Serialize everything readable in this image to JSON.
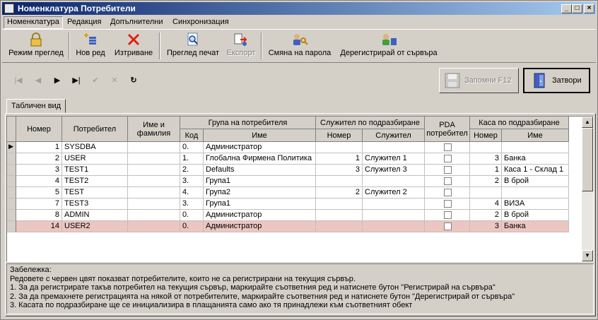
{
  "window": {
    "title": "Номенклатура Потребители"
  },
  "menu": [
    "Номенклатура",
    "Редакция",
    "Допълнителни",
    "Синхронизация"
  ],
  "toolbar": {
    "view_mode": "Режим преглед",
    "new_row": "Нов ред",
    "delete": "Изтриване",
    "print_preview": "Преглед печат",
    "export": "Експорт",
    "change_password": "Смяна на парола",
    "deregister": "Дерегистрирай от сървъра"
  },
  "buttons": {
    "save": "Запомни  F12",
    "close": "Затвори"
  },
  "tabs": {
    "table_view": "Табличен вид"
  },
  "grid": {
    "headers": {
      "number": "Номер",
      "user": "Потребител",
      "name_family": "Име и фамилия",
      "user_group": "Група на потребителя",
      "group_code": "Код",
      "group_name": "Име",
      "default_employee": "Служител по подразбиране",
      "emp_number": "Номер",
      "emp_name": "Служител",
      "pda": "PDA потребител",
      "default_cash": "Каса по подразбиране",
      "cash_number": "Номер",
      "cash_name": "Име"
    },
    "rows": [
      {
        "num": "1",
        "user": "SYSDBA",
        "name": "",
        "code": "0.",
        "group": "Администратор",
        "emp_num": "",
        "emp": "",
        "cash_num": "",
        "cash": ""
      },
      {
        "num": "2",
        "user": "USER",
        "name": "",
        "code": "1.",
        "group": "Глобална Фирмена Политика",
        "emp_num": "1",
        "emp": "Служител 1",
        "cash_num": "3",
        "cash": "Банка"
      },
      {
        "num": "3",
        "user": "TEST1",
        "name": "",
        "code": "2.",
        "group": "Defaults",
        "emp_num": "3",
        "emp": "Служител 3",
        "cash_num": "1",
        "cash": "Каса 1 - Склад 1"
      },
      {
        "num": "4",
        "user": "TEST2",
        "name": "",
        "code": "3.",
        "group": "Група1",
        "emp_num": "",
        "emp": "",
        "cash_num": "2",
        "cash": "В брой"
      },
      {
        "num": "5",
        "user": "TEST",
        "name": "",
        "code": "4.",
        "group": "Група2",
        "emp_num": "2",
        "emp": "Служител 2",
        "cash_num": "",
        "cash": ""
      },
      {
        "num": "7",
        "user": "TEST3",
        "name": "",
        "code": "3.",
        "group": "Група1",
        "emp_num": "",
        "emp": "",
        "cash_num": "4",
        "cash": "ВИЗА"
      },
      {
        "num": "8",
        "user": "ADMIN",
        "name": "",
        "code": "0.",
        "group": "Администратор",
        "emp_num": "",
        "emp": "",
        "cash_num": "2",
        "cash": "В брой"
      },
      {
        "num": "14",
        "user": "USER2",
        "name": "",
        "code": "0.",
        "group": "Администратор",
        "emp_num": "",
        "emp": "",
        "cash_num": "3",
        "cash": "Банка"
      }
    ]
  },
  "colors": {
    "unregistered_row": "#ecc6c0",
    "title_start": "#0a246a",
    "title_end": "#a6caf0"
  },
  "notes": [
    "Забележка:",
    "Редовете с червен цвят показват потребителите, които не са регистрирани на текущия сървър.",
    "1. За да регистрирате такъв потребител на текущия сървър, маркирайте съответния ред и натиснете бутон \"Регистрирай на сървъра\"",
    "2. За да премахнете регистрацията на някой от потребителите, маркирайте съответния ред и натиснете бутон \"Дерегистрирай от сървъра\"",
    "3. Касата по подразбиране ще се инициализира в плащанията само ако тя принадлежи към съответният обект"
  ]
}
